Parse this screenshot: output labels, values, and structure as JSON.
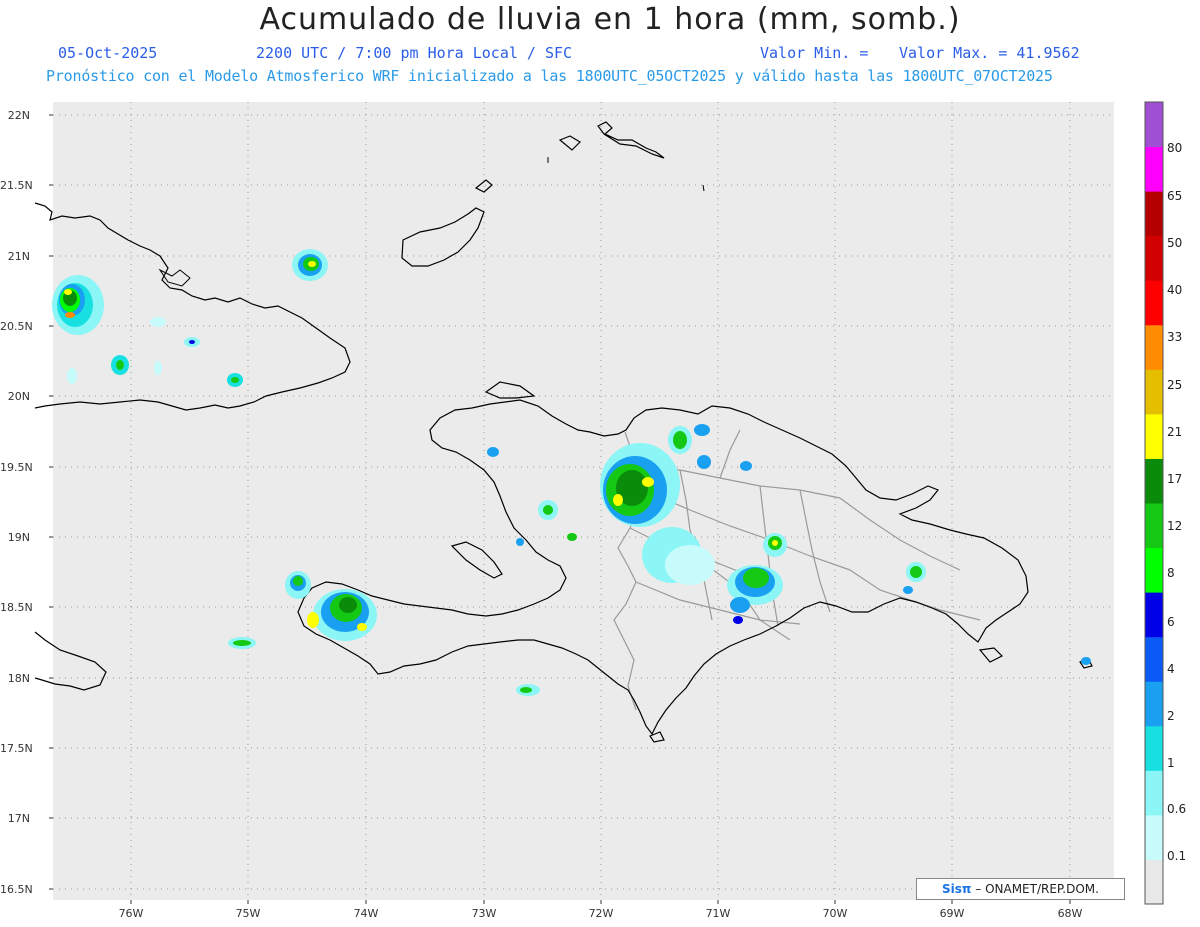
{
  "header": {
    "title": "Acumulado de lluvia en 1 hora (mm, somb.)",
    "date": "05-Oct-2025",
    "time": "2200 UTC / 7:00 pm Hora Local / SFC",
    "min_label": "Valor Min. =",
    "max_label": "Valor Max. = 41.9562",
    "subtitle": "Pronóstico con el Modelo Atmosferico WRF inicializado a las 1800UTC_05OCT2025 y válido hasta las  1800UTC_07OCT2025"
  },
  "map": {
    "lat_labels": [
      "22N",
      "21.5N",
      "21N",
      "20.5N",
      "20N",
      "19.5N",
      "19N",
      "18.5N",
      "18N",
      "17.5N",
      "17N",
      "16.5N"
    ],
    "lon_labels": [
      "76W",
      "75W",
      "74W",
      "73W",
      "72W",
      "71W",
      "70W",
      "69W",
      "68W"
    ],
    "background_color": "#ebebeb",
    "coast_color": "#000000",
    "border_color": "#9a9a9a"
  },
  "colorbar": {
    "labels": [
      "0.1",
      "0.6",
      "1",
      "2",
      "4",
      "6",
      "8",
      "12",
      "17",
      "21",
      "25",
      "33",
      "40",
      "50",
      "65",
      "80"
    ],
    "colors": [
      "#e8e8e8",
      "#c8fcfc",
      "#8cf5f5",
      "#18e0e0",
      "#19a0f0",
      "#0a5af5",
      "#0000e6",
      "#00ff00",
      "#14c814",
      "#0a8c0a",
      "#ffff00",
      "#e6be00",
      "#ff8c00",
      "#ff0000",
      "#d20000",
      "#b40000",
      "#ff00ff",
      "#a050d2"
    ]
  },
  "footer": {
    "logo_text": "Sisπ",
    "credit": "– ONAMET/REP.DOM."
  }
}
